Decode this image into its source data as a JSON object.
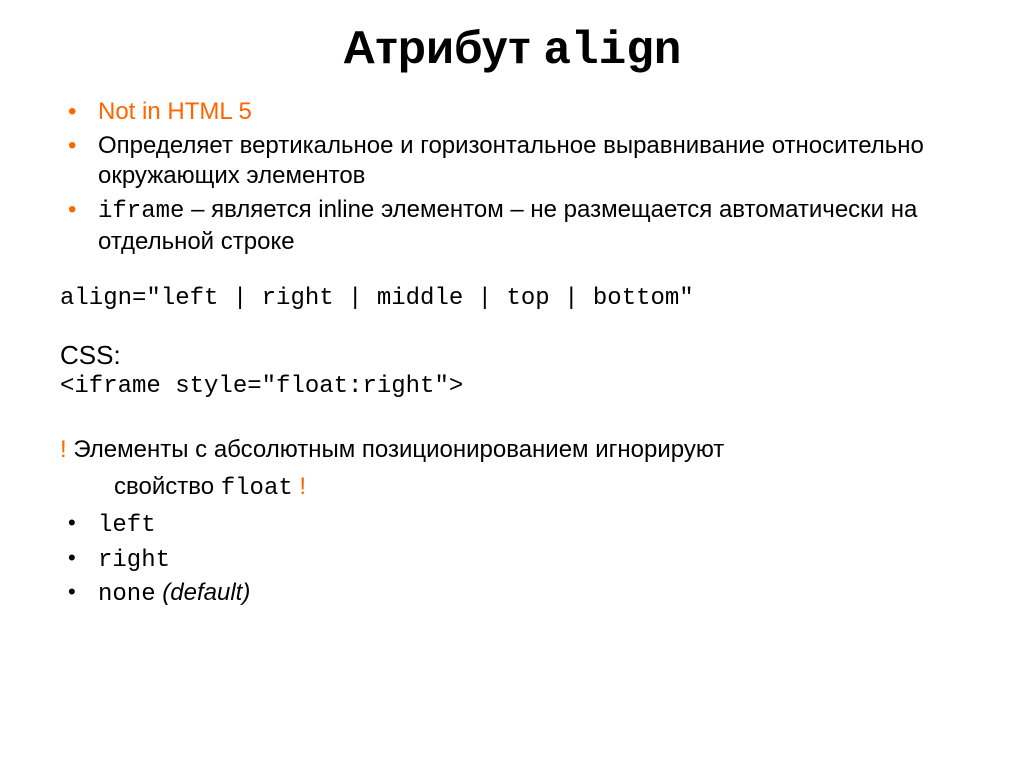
{
  "title": {
    "word": "Атрибут",
    "code": "align"
  },
  "bullets": {
    "b1": "Not in HTML 5",
    "b2": "Определяет вертикальное и горизонтальное выравнивание относительно окружающих элементов",
    "b3_code": "iframe",
    "b3_rest": " – является inline элементом – не размещается автоматически на отдельной строке"
  },
  "align_values": "align=\"left | right | middle | top | bottom\"",
  "css_label": "CSS:",
  "iframe_example": "<iframe style=\"float:right\">",
  "warning": {
    "bang1": "!",
    "line1": " Элементы с абсолютным позиционированием игнорируют",
    "line2_a": "свойство ",
    "line2_code": "float",
    "bang2": " !"
  },
  "float_values": {
    "v1": "left",
    "v2": "right",
    "v3": "none",
    "v3_default": " (default)"
  }
}
